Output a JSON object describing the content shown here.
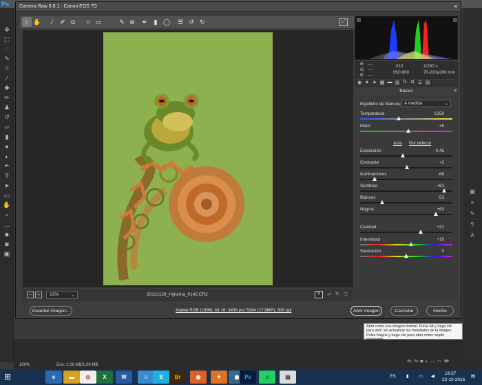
{
  "dialog": {
    "title": "Camera Raw 9.6.1 -  Canon EOS 7D",
    "close_icon": "close-icon"
  },
  "toolbar": {
    "tools": [
      "zoom-icon",
      "hand-icon",
      "white-balance-icon",
      "color-sampler-icon",
      "targeted-adjust-icon",
      "crop-icon",
      "straighten-icon",
      "spot-removal-icon",
      "red-eye-icon",
      "adjustment-brush-icon",
      "graduated-filter-icon",
      "radial-filter-icon",
      "preferences-icon",
      "rotate-ccw-icon",
      "rotate-cw-icon"
    ]
  },
  "preview": {
    "zoom_value": "13%",
    "filename": "20131129_Hylorina_0142.CR2",
    "y_label": "Y"
  },
  "footer": {
    "save_label": "Guardar imagen...",
    "workflow_link": "Adobe RGB (1998); bit 16; 3456 por 5184 (17,9MP); 300 ppi",
    "open_label": "Abrir imagen",
    "cancel_label": "Cancelar",
    "done_label": "Hecho"
  },
  "info": {
    "r": "R:",
    "g": "G:",
    "b": "B:",
    "r_val": "---",
    "g_val": "---",
    "b_val": "---",
    "aperture": "f/10",
    "shutter": "1/250 s",
    "iso": "ISO 800",
    "lens": "70-200a200 mm"
  },
  "histogram": {
    "colors": {
      "blue": "#1a3cff",
      "green": "#20d020",
      "red": "#ff2020"
    }
  },
  "panel": {
    "title": "Básico",
    "wb_label": "Equilibrio de blancos:",
    "wb_value": "A medida",
    "auto_label": "Auto",
    "default_label": "Por defecto",
    "sliders": [
      {
        "label": "Temperatura",
        "value": "6150",
        "pos": 0.42
      },
      {
        "label": "Matiz",
        "value": "+5",
        "pos": 0.52
      },
      {
        "label": "Exposición",
        "value": "-0,45",
        "pos": 0.46
      },
      {
        "label": "Contraste",
        "value": "+2",
        "pos": 0.51
      },
      {
        "label": "Iluminaciones",
        "value": "-68",
        "pos": 0.16
      },
      {
        "label": "Sombras",
        "value": "+81",
        "pos": 0.91
      },
      {
        "label": "Blancos",
        "value": "-53",
        "pos": 0.24
      },
      {
        "label": "Negros",
        "value": "+63",
        "pos": 0.82
      },
      {
        "label": "Claridad",
        "value": "+31",
        "pos": 0.66
      },
      {
        "label": "Intensidad",
        "value": "+10",
        "pos": 0.55
      },
      {
        "label": "Saturación",
        "value": "0",
        "pos": 0.5
      }
    ]
  },
  "ps": {
    "logo": "Ps",
    "status_zoom": "100%",
    "status_doc": "Doc: 1,08 MB/1,08 MB",
    "tooltip": "Abrir como una imagen normal. Pulse Alt y haga clic para abrir sin actualizar los metadatos de la imagen.  Pulse Mayús y haga clic para abrir como objeto inteligente."
  },
  "taskbar": {
    "lang": "ES",
    "time": "19:37",
    "date": "22-10-2016"
  }
}
